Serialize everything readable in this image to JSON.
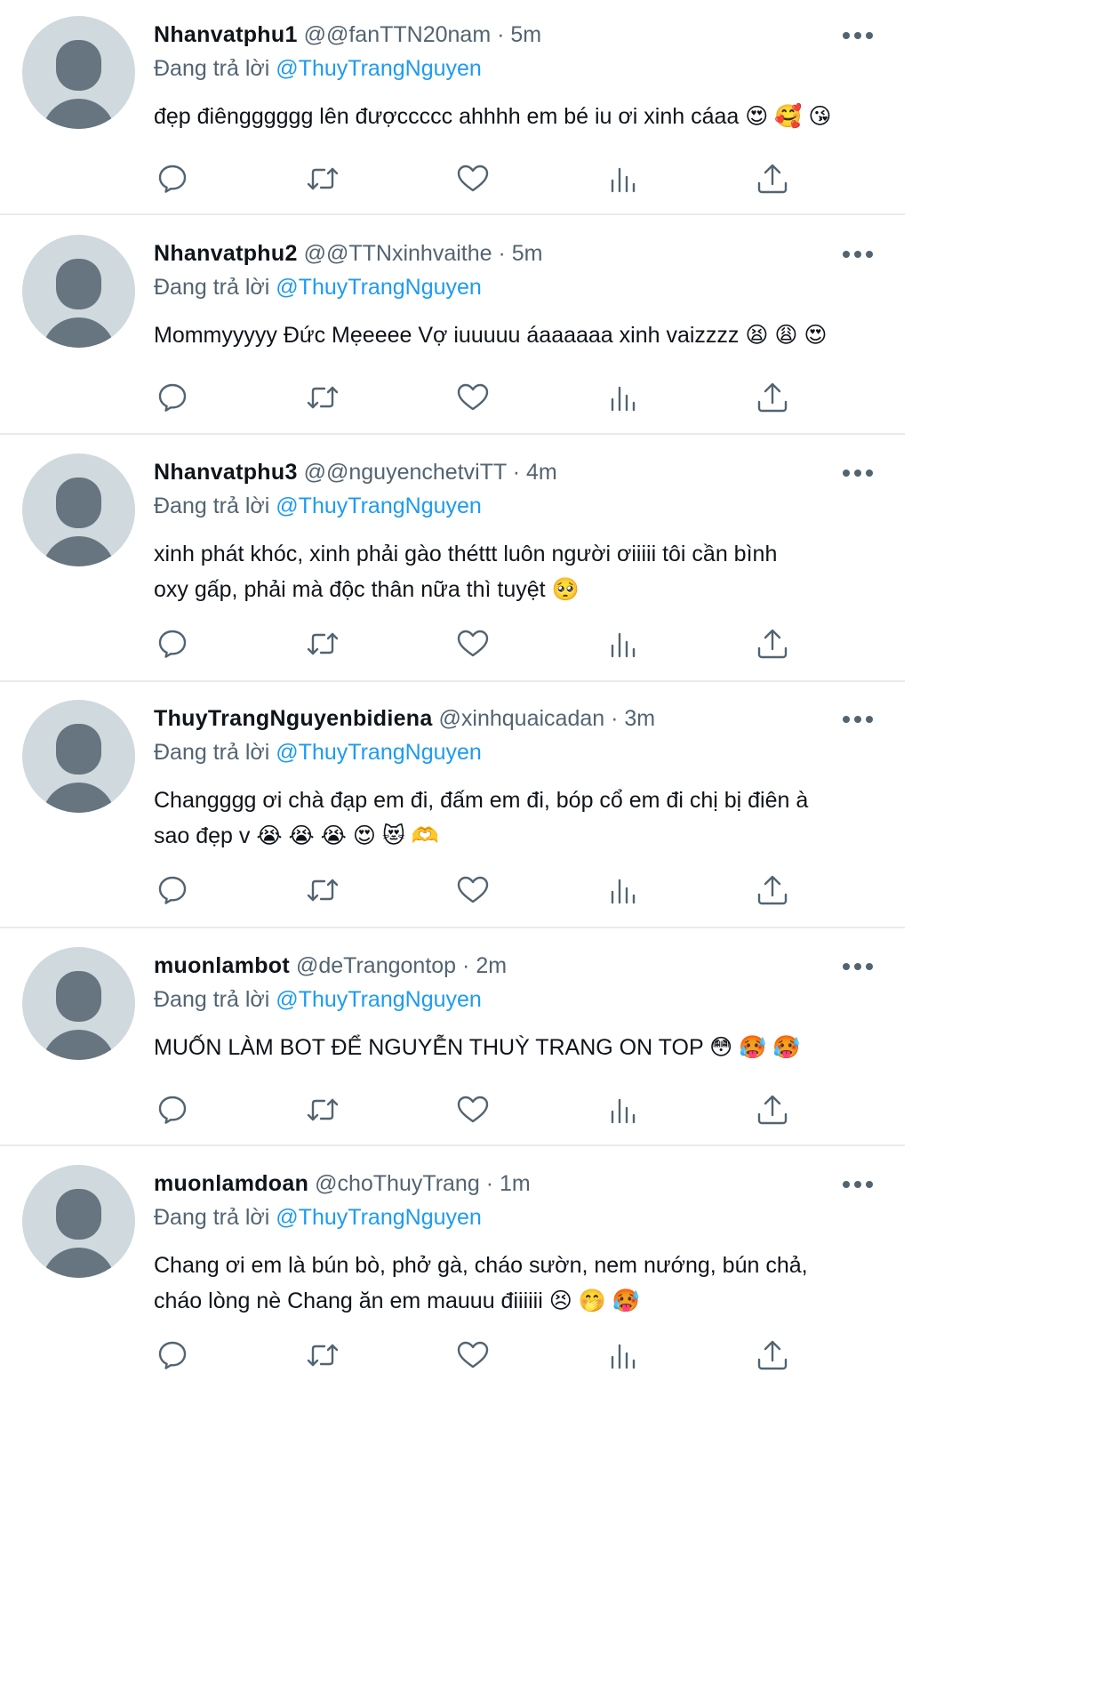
{
  "tweets": [
    {
      "name": "Nhanvatphu1",
      "handle": "@@fanTTN20nam",
      "separator": "·",
      "time": "5m",
      "reply_prefix": "Đang trả lời",
      "reply_to": "@ThuyTrangNguyen",
      "lines": [
        "đẹp điêngggggg lên đượccccc ahhhh em bé iu ơi xinh cáaa 😍 🥰 😘"
      ]
    },
    {
      "name": "Nhanvatphu2",
      "handle": "@@TTNxinhvaithe",
      "separator": "·",
      "time": "5m",
      "reply_prefix": "Đang trả lời",
      "reply_to": "@ThuyTrangNguyen",
      "lines": [
        "Mommyyyyy Đức Mẹeeee Vợ iuuuuu áaaaaaa xinh vaizzzz 😫 😩 😍"
      ]
    },
    {
      "name": "Nhanvatphu3",
      "handle": "@@nguyenchetviTT",
      "separator": "·",
      "time": "4m",
      "reply_prefix": "Đang trả lời",
      "reply_to": "@ThuyTrangNguyen",
      "lines": [
        "xinh phát khóc, xinh phải gào théttt luôn người ơiiiii tôi cần bình",
        "oxy gấp, phải mà độc thân nữa thì tuyệt 🥺"
      ]
    },
    {
      "name": "ThuyTrangNguyenbidiena",
      "handle": "@xinhquaicadan",
      "separator": "·",
      "time": "3m",
      "reply_prefix": "Đang trả lời",
      "reply_to": "@ThuyTrangNguyen",
      "lines": [
        "Changggg ơi chà đạp em đi, đấm em đi, bóp cổ em đi chị bị điên à",
        "sao đẹp v 😭 😭 😭 😍 😻 🫶"
      ]
    },
    {
      "name": "muonlambot",
      "handle": "@deTrangontop",
      "separator": "·",
      "time": "2m",
      "reply_prefix": "Đang trả lời",
      "reply_to": "@ThuyTrangNguyen",
      "lines": [
        "MUỐN LÀM BOT ĐỂ NGUYỄN THUỲ TRANG ON TOP 😳 🥵 🥵"
      ]
    },
    {
      "name": "muonlamdoan",
      "handle": "@choThuyTrang",
      "separator": "·",
      "time": "1m",
      "reply_prefix": "Đang trả lời",
      "reply_to": "@ThuyTrangNguyen",
      "lines": [
        "Chang ơi em là bún bò, phở gà, cháo sườn, nem nướng, bún chả,",
        "cháo lòng nè Chang ăn em mauuu điiiiii 😣 🤭 🥵"
      ]
    }
  ],
  "icons": {
    "avatar": "default-avatar-icon",
    "more": "more-dots-icon",
    "reply": "reply-bubble-icon",
    "retweet": "retweet-arrows-icon",
    "like": "heart-icon",
    "views": "bar-chart-icon",
    "share": "share-upload-icon"
  },
  "colors": {
    "name": "#0f1419",
    "secondary": "#536471",
    "mention": "#1d9bf0",
    "divider": "#e8ebed",
    "avatar_bg": "#cfd9de",
    "avatar_fg": "#66757f"
  }
}
